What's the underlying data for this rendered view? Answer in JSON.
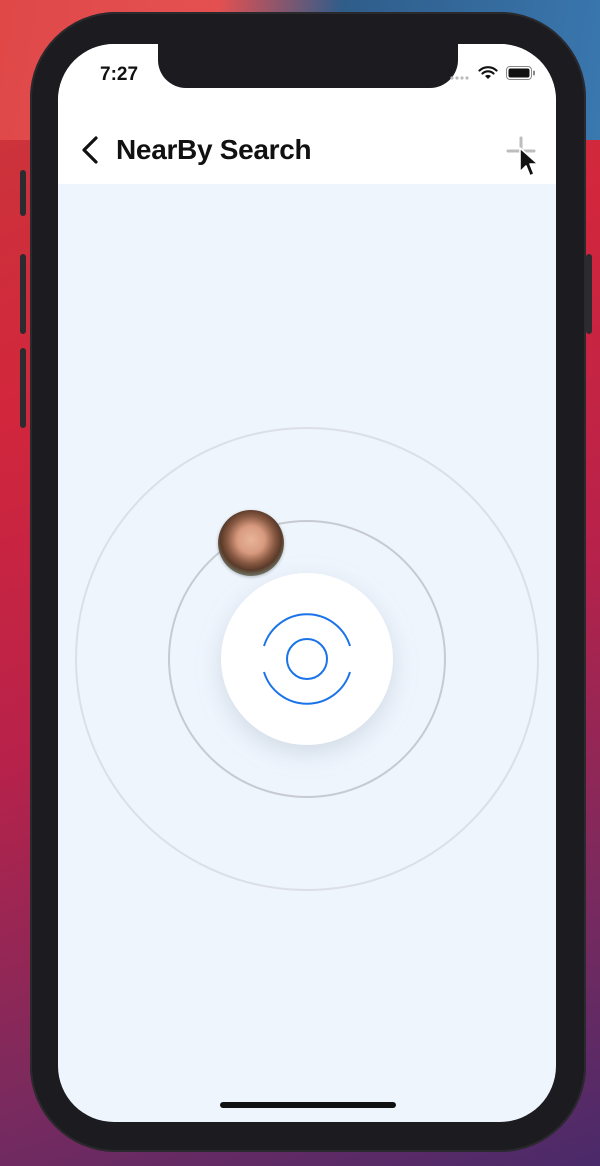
{
  "status_bar": {
    "time": "7:27",
    "wifi_icon": "wifi-icon",
    "battery_icon": "battery-icon"
  },
  "nav": {
    "back_icon": "chevron-left-icon",
    "title": "NearBy Search",
    "add_icon": "plus-icon"
  },
  "radar": {
    "center_icon": "nearby-scan-icon",
    "ring_color": "#cdd0d8",
    "accent_color": "#1a73e8",
    "background_color": "#eef5fd"
  },
  "users": [
    {
      "avatar": "user-avatar"
    }
  ]
}
